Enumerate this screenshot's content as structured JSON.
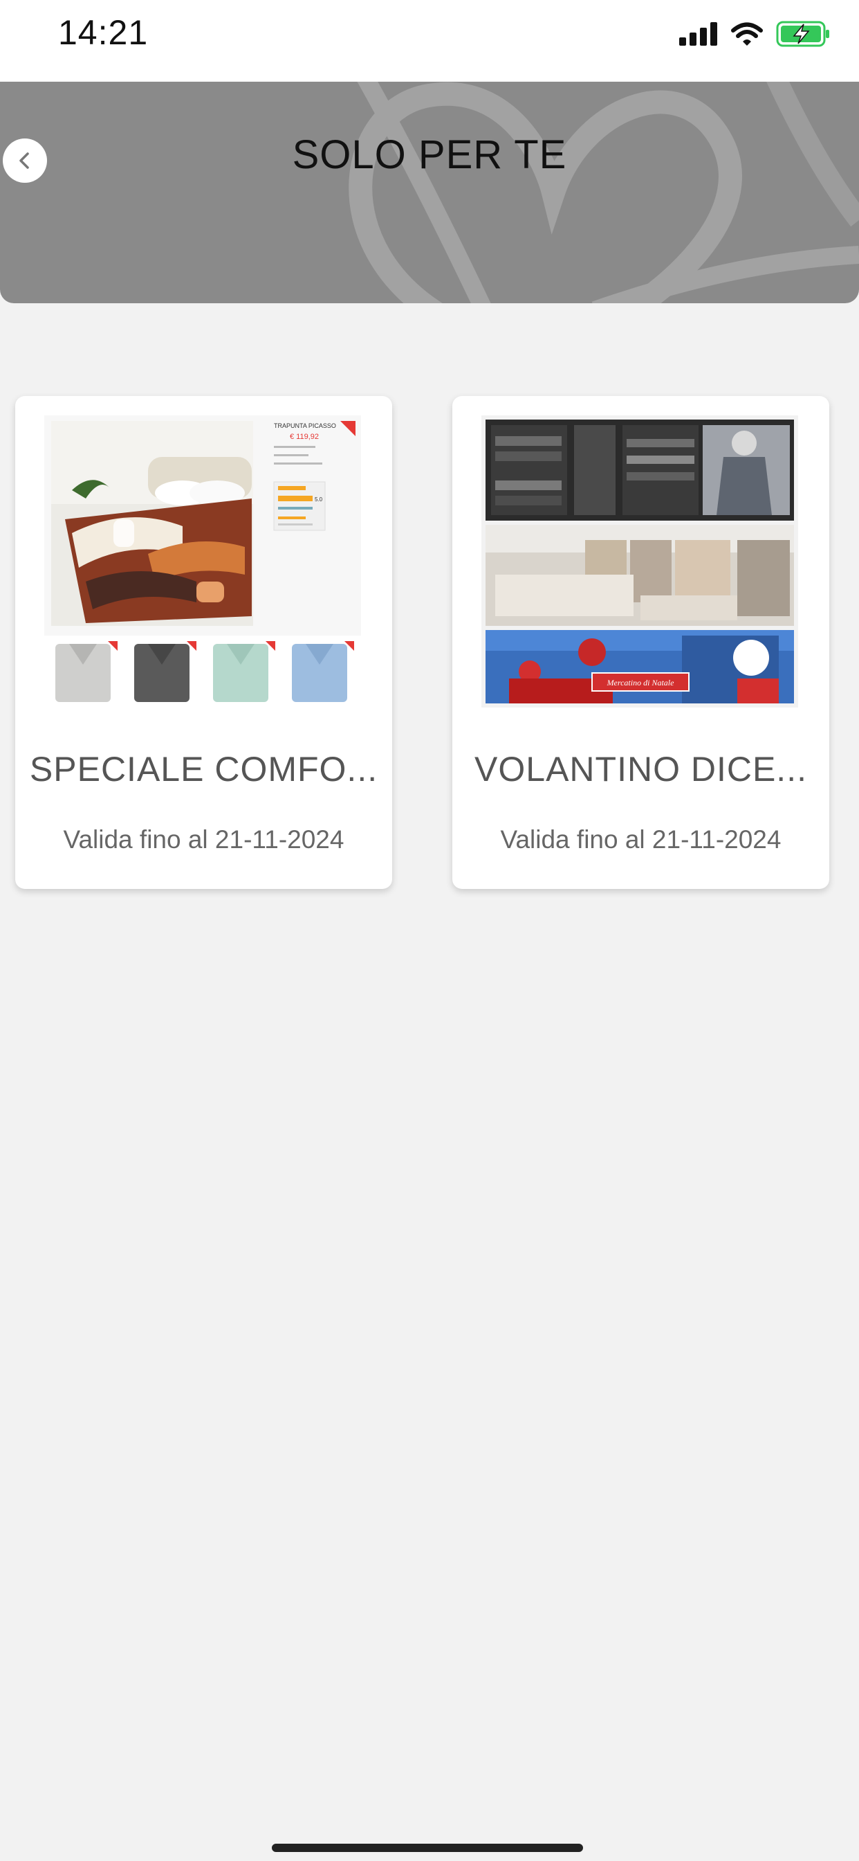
{
  "status_bar": {
    "time": "14:21",
    "icons": [
      "signal-icon",
      "wifi-icon",
      "battery-charging-icon"
    ]
  },
  "header": {
    "title": "SOLO PER TE",
    "back_icon": "chevron-left-icon",
    "background_color": "#8a8a8a"
  },
  "offers": [
    {
      "title": "SPECIALE COMFO...",
      "validity": "Valida fino al 21-11-2024",
      "image": "comforter-and-bathrobes-promo-image",
      "image_texts": {
        "product_name": "TRAPUNTA PICASSO",
        "price": "€ 119,92",
        "rating": "5.0"
      }
    },
    {
      "title": "VOLANTINO DICE...",
      "validity": "Valida fino al 21-11-2024",
      "image": "store-interior-christmas-market-image",
      "image_texts": {
        "banner": "Mercatino di Natale"
      }
    }
  ],
  "colors": {
    "page_background": "#f2f2f2",
    "card_background": "#ffffff",
    "title_text": "#555555",
    "battery_green": "#34c759"
  }
}
